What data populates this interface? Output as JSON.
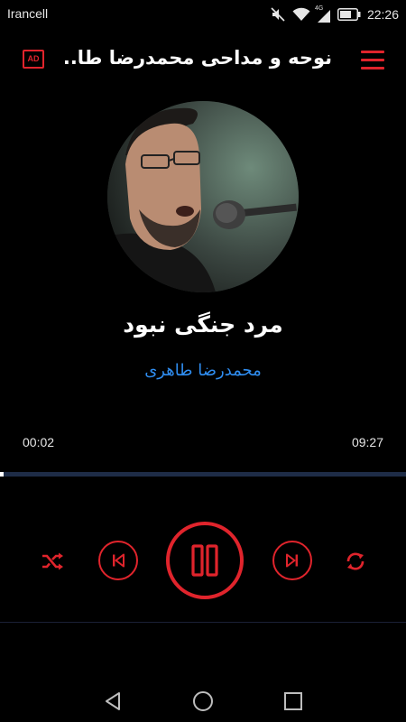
{
  "status_bar": {
    "carrier": "Irancell",
    "network_type": "4G",
    "time": "22:26",
    "icons": [
      "mute-vibrate-icon",
      "wifi-icon",
      "signal-icon",
      "battery-icon"
    ]
  },
  "toolbar": {
    "title": "نوحه و مداحی محمدرضا طا...",
    "ad_label": "AD",
    "menu_icon": "hamburger-menu-icon"
  },
  "track": {
    "title": "مرد جنگی نبود",
    "artist": "محمدرضا طاهری",
    "current_time": "00:02",
    "total_time": "09:27",
    "progress_fraction": 0.0035
  },
  "controls": {
    "shuffle_icon": "shuffle-icon",
    "prev_icon": "skip-previous-icon",
    "play_pause_icon": "pause-icon",
    "next_icon": "skip-next-icon",
    "repeat_icon": "repeat-icon"
  },
  "colors": {
    "accent": "#e0242c",
    "artist": "#2f8df0",
    "background": "#000000",
    "progress_track": "#1e2c47"
  }
}
